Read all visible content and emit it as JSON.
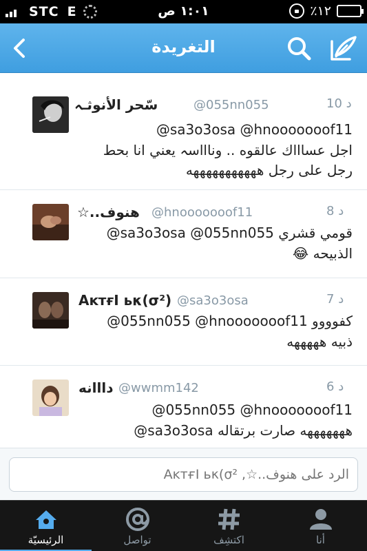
{
  "status_bar": {
    "carrier": "STC",
    "network": "E",
    "time": "١:٠١ ص",
    "battery": "٪١٢",
    "battery_level": 0.12
  },
  "nav": {
    "title": "التغريدة",
    "back_icon": "chevron-left-icon",
    "search_icon": "search-icon",
    "compose_icon": "compose-icon"
  },
  "tweets": [
    {
      "time": "10 د",
      "name": "سّحر الأنوثـہ",
      "handle": "@055nn055",
      "lines": [
        "@sa3o3osa @hnooooooof11",
        "اجل عساااك عالقوه .. وناااسہ يعني انا بحط",
        "رجل على رجل هههههههههههه"
      ]
    },
    {
      "time": "8 د",
      "name": "ھنوف..☆",
      "handle": "@hnooooooof11",
      "lines": [
        "@sa3o3osa @055nn055 قومي قشري",
        "الذبيحه 😂"
      ]
    },
    {
      "time": "7 د",
      "name": "AĸтғΙ ьκ(σ²)",
      "handle": "@sa3o3osa",
      "lines": [
        "@055nn055 @hnooooooof11 كفوووو",
        "ذبيه هههههه"
      ]
    },
    {
      "time": "6 د",
      "name": "دااانه",
      "handle": "@wwmm142",
      "lines": [
        "@055nn055 @hnooooooof11",
        "@sa3o3osa هههههههه صارت برتقاله"
      ]
    }
  ],
  "reply": {
    "placeholder": "الرد على ھنوف..☆, AĸтғΙ ьκ(σ²"
  },
  "tabs": [
    {
      "label": "الرئيسيّة",
      "icon": "home-icon",
      "active": true
    },
    {
      "label": "تواصل",
      "icon": "at-icon",
      "active": false
    },
    {
      "label": "اكتشِف",
      "icon": "hashtag-icon",
      "active": false
    },
    {
      "label": "أنا",
      "icon": "person-icon",
      "active": false
    }
  ],
  "colors": {
    "nav_blue": "#4aa8e6",
    "tab_bar": "#161616",
    "accent": "#55acee",
    "meta_gray": "#8899a6"
  }
}
